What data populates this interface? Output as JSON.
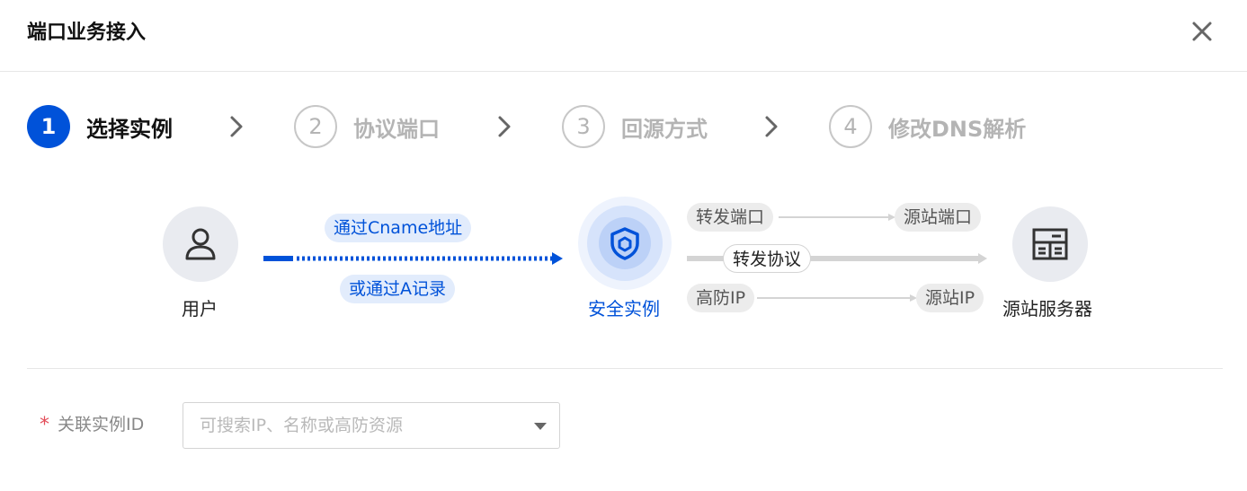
{
  "dialog": {
    "title": "端口业务接入",
    "close_icon": "close-icon"
  },
  "steps": [
    {
      "number": "1",
      "label": "选择实例",
      "state": "active"
    },
    {
      "number": "2",
      "label": "协议端口",
      "state": "inactive"
    },
    {
      "number": "3",
      "label": "回源方式",
      "state": "inactive"
    },
    {
      "number": "4",
      "label": "修改DNS解析",
      "state": "inactive"
    }
  ],
  "diagram": {
    "user": {
      "label": "用户",
      "icon": "user-icon"
    },
    "cname_pill": "通过Cname地址",
    "arecord_pill": "或通过A记录",
    "instance": {
      "label": "安全实例",
      "icon": "shield-icon"
    },
    "forward_port": "转发端口",
    "origin_port": "源站端口",
    "forward_protocol": "转发协议",
    "anti_ddos_ip": "高防IP",
    "origin_ip": "源站IP",
    "server": {
      "label": "源站服务器",
      "icon": "server-icon"
    }
  },
  "form": {
    "required_mark": "*",
    "instance_id_label": "关联实例ID",
    "instance_select_placeholder": "可搜索IP、名称或高防资源"
  },
  "colors": {
    "primary": "#0052d9",
    "required": "#e34d59",
    "muted": "#b4b4b4"
  }
}
